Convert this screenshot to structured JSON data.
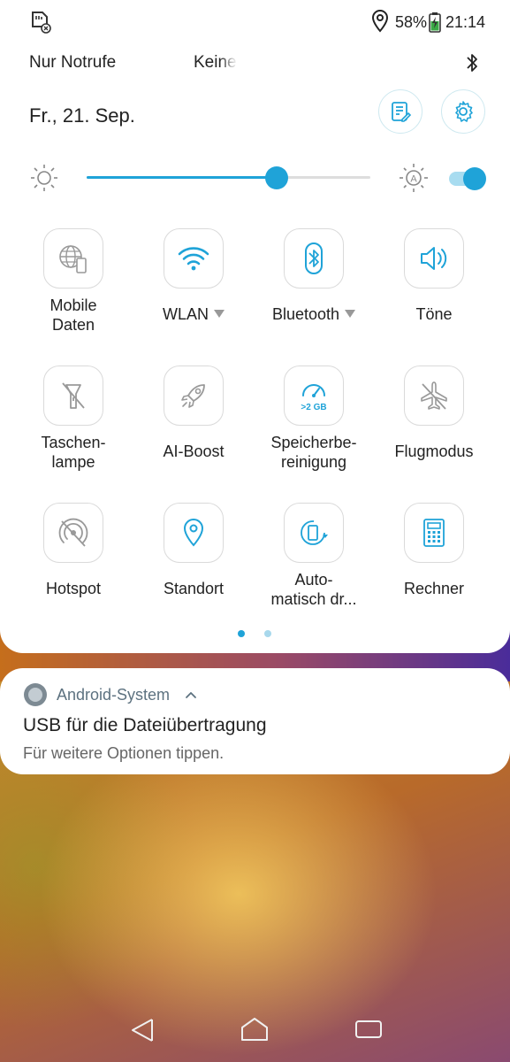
{
  "status_bar": {
    "battery_percent": "58%",
    "time": "21:14",
    "icons": [
      "sim-card-icon",
      "location-icon",
      "battery-charging-icon"
    ]
  },
  "network": {
    "operator1": "Nur Notrufe",
    "operator2": "Keine",
    "icon": "bluetooth-icon"
  },
  "header": {
    "date": "Fr., 21. Sep.",
    "edit_icon": "edit-list-icon",
    "settings_icon": "gear-icon"
  },
  "brightness": {
    "level": 0.67,
    "auto_enabled": true
  },
  "tiles": [
    {
      "label": "Mobile\nDaten",
      "icon": "mobile-data-icon",
      "active": false,
      "has_menu": false
    },
    {
      "label": "WLAN",
      "icon": "wifi-icon",
      "active": true,
      "has_menu": true
    },
    {
      "label": "Bluetooth",
      "icon": "bluetooth-icon",
      "active": true,
      "has_menu": true
    },
    {
      "label": "Töne",
      "icon": "speaker-icon",
      "active": true,
      "has_menu": false
    },
    {
      "label": "Taschen-\nlampe",
      "icon": "flashlight-off-icon",
      "active": false,
      "has_menu": false
    },
    {
      "label": "AI-Boost",
      "icon": "rocket-icon",
      "active": false,
      "has_menu": false
    },
    {
      "label": "Speicherbe-\nreinigung",
      "icon": "memory-cleaner-icon",
      "badge": ">2 GB",
      "active": true,
      "has_menu": false
    },
    {
      "label": "Flugmodus",
      "icon": "airplane-off-icon",
      "active": false,
      "has_menu": false
    },
    {
      "label": "Hotspot",
      "icon": "hotspot-off-icon",
      "active": false,
      "has_menu": false
    },
    {
      "label": "Standort",
      "icon": "location-icon",
      "active": true,
      "has_menu": false
    },
    {
      "label": "Auto-\nmatisch dr...",
      "icon": "auto-rotate-icon",
      "active": true,
      "has_menu": false
    },
    {
      "label": "Rechner",
      "icon": "calculator-icon",
      "active": true,
      "has_menu": false
    }
  ],
  "pager": {
    "pages": 2,
    "current": 0
  },
  "notification": {
    "app": "Android-System",
    "title": "USB für die Dateiübertragung",
    "text": "Für weitere Optionen tippen."
  },
  "colors": {
    "accent": "#1fa3d8",
    "inactive": "#9a9a9a"
  }
}
